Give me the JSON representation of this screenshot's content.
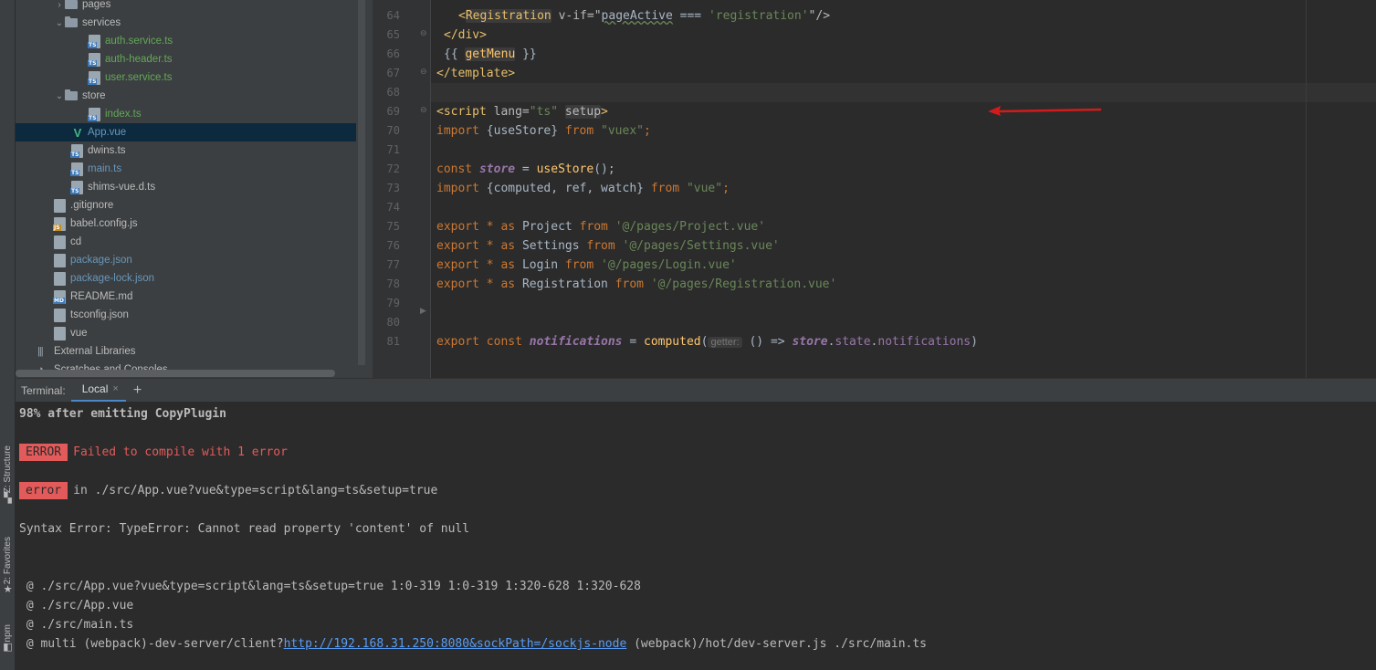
{
  "tool_strip": {
    "structure": "Z: Structure",
    "favorites": "2: Favorites",
    "npm": "npm"
  },
  "tree": {
    "items": [
      {
        "label": "pages",
        "kind": "folder",
        "expanded": false,
        "color": "#bbbbbb"
      },
      {
        "label": "services",
        "kind": "folder",
        "expanded": true,
        "color": "#bbbbbb"
      },
      {
        "label": "auth.service.ts",
        "kind": "ts",
        "color": "#62a857"
      },
      {
        "label": "auth-header.ts",
        "kind": "ts",
        "color": "#62a857"
      },
      {
        "label": "user.service.ts",
        "kind": "ts",
        "color": "#62a857"
      },
      {
        "label": "store",
        "kind": "folder",
        "expanded": true,
        "color": "#bbbbbb"
      },
      {
        "label": "index.ts",
        "kind": "ts",
        "color": "#62a857"
      },
      {
        "label": "App.vue",
        "kind": "vue",
        "color": "#6897bb",
        "selected": true
      },
      {
        "label": "dwins.ts",
        "kind": "ts",
        "color": "#bbbbbb"
      },
      {
        "label": "main.ts",
        "kind": "ts",
        "color": "#6897bb"
      },
      {
        "label": "shims-vue.d.ts",
        "kind": "ts",
        "color": "#bbbbbb"
      },
      {
        "label": ".gitignore",
        "kind": "file",
        "color": "#bbbbbb"
      },
      {
        "label": "babel.config.js",
        "kind": "js",
        "color": "#bbbbbb"
      },
      {
        "label": "cd",
        "kind": "file",
        "color": "#bbbbbb"
      },
      {
        "label": "package.json",
        "kind": "file",
        "color": "#6897bb"
      },
      {
        "label": "package-lock.json",
        "kind": "file",
        "color": "#6897bb"
      },
      {
        "label": "README.md",
        "kind": "md",
        "color": "#bbbbbb"
      },
      {
        "label": "tsconfig.json",
        "kind": "file",
        "color": "#bbbbbb"
      },
      {
        "label": "vue",
        "kind": "file",
        "color": "#bbbbbb"
      },
      {
        "label": "External Libraries",
        "kind": "lib",
        "color": "#bbbbbb"
      },
      {
        "label": "Scratches and Consoles",
        "kind": "scratch",
        "color": "#bbbbbb"
      }
    ]
  },
  "editor": {
    "line_numbers": [
      "64",
      "65",
      "66",
      "67",
      "68",
      "69",
      "70",
      "71",
      "72",
      "73",
      "74",
      "75",
      "76",
      "77",
      "78",
      "79",
      "80",
      "81"
    ],
    "lines": {
      "l64_open": "<",
      "l64_tag": "Registration",
      "l64_attr": " v-if=\"",
      "l64_expr": "pageActive",
      "l64_op": " === ",
      "l64_str": "'registration'",
      "l64_close": "\"/>",
      "l65": "</div>",
      "l66_open": "{{ ",
      "l66_fn": "getMenu",
      "l66_close": " }}",
      "l67": "</template>",
      "l69_open": "<script",
      "l69_attr": " lang=",
      "l69_str": "\"ts\"",
      "l69_setup": "setup",
      "l69_close": ">",
      "l70_kw": "import",
      "l70_mid": " {useStore} ",
      "l70_from": "from",
      "l70_str": " \"vuex\"",
      "l70_end": ";",
      "l72_kw": "const",
      "l72_var": "store",
      "l72_eq": " = ",
      "l72_fn": "useStore",
      "l72_end": "();",
      "l73_kw": "import",
      "l73_mid": " {computed, ref, watch} ",
      "l73_from": "from",
      "l73_str": " \"vue\"",
      "l73_end": ";",
      "l75_name": "Project",
      "l75_path": "'@/pages/Project.vue'",
      "l76_name": "Settings",
      "l76_path": "'@/pages/Settings.vue'",
      "l77_name": "Login",
      "l77_path": "'@/pages/Login.vue'",
      "l78_name": "Registration",
      "l78_path": "'@/pages/Registration.vue'",
      "export_kw": "export",
      "star_as": " * as ",
      "from_kw": "from",
      "l81_export": "export",
      "l81_const": "const",
      "l81_var": "notifications",
      "l81_eq": " = ",
      "l81_fn": "computed",
      "l81_paren": "(",
      "l81_hint": "getter:",
      "l81_arrow": " () => ",
      "l81_store": "store",
      "l81_state": "state",
      "l81_notif": "notifications",
      "l81_close": ")"
    }
  },
  "terminal": {
    "title": "Terminal:",
    "tab": "Local",
    "tab_close": "×",
    "add": "+",
    "line1": "98% after emitting CopyPlugin",
    "error_badge": "ERROR",
    "error_msg": "Failed to compile with 1 error",
    "error_badge2": "error",
    "error_loc": "in ./src/App.vue?vue&type=script&lang=ts&setup=true",
    "syntax_err": "Syntax Error: TypeError: Cannot read property 'content' of null",
    "stack1": " @ ./src/App.vue?vue&type=script&lang=ts&setup=true 1:0-319 1:0-319 1:320-628 1:320-628",
    "stack2": " @ ./src/App.vue",
    "stack3": " @ ./src/main.ts",
    "stack4_pre": " @ multi (webpack)-dev-server/client?",
    "stack4_link": "http://192.168.31.250:8080&sockPath=/sockjs-node",
    "stack4_post": " (webpack)/hot/dev-server.js ./src/main.ts"
  },
  "colors": {
    "accent": "#4a88c7",
    "error": "#e35a5a",
    "arrow": "#d31b1b"
  }
}
